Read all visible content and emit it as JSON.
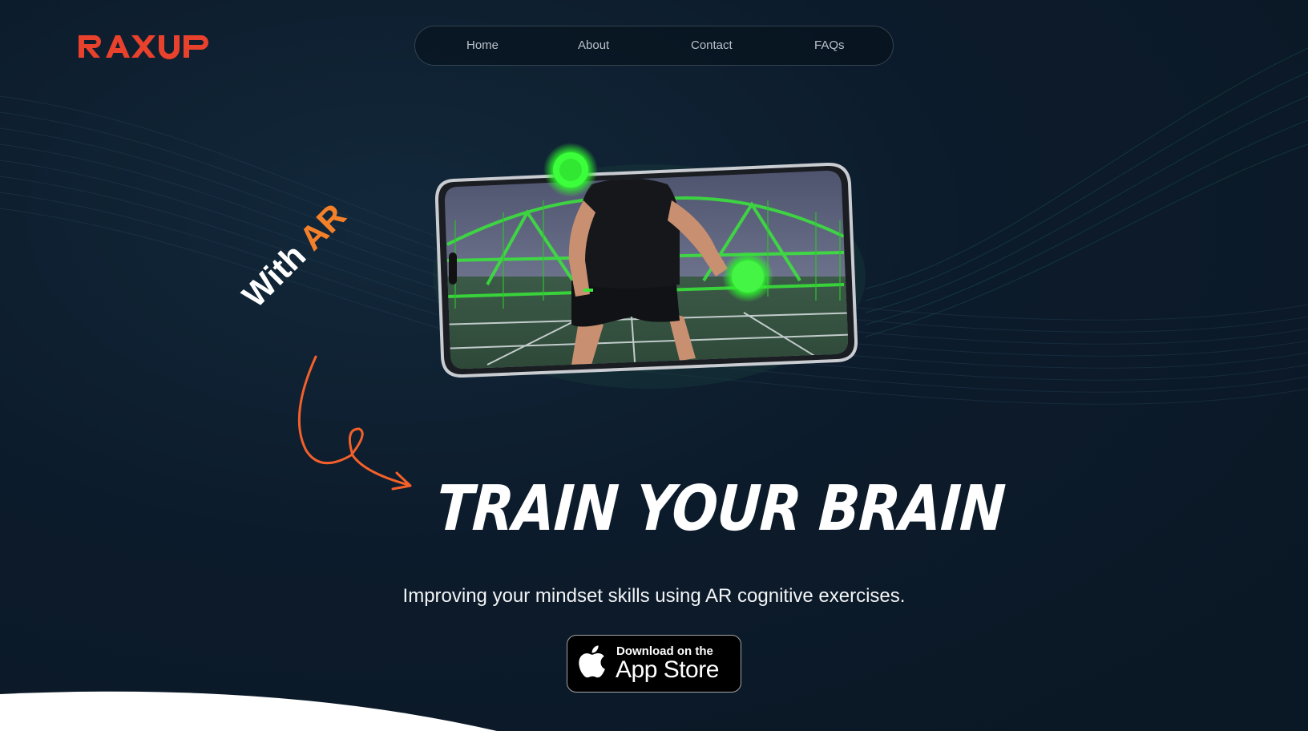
{
  "brand": {
    "logo_text": "RAXUP",
    "logo_color": "#e8412c"
  },
  "nav": {
    "items": [
      {
        "label": "Home"
      },
      {
        "label": "About"
      },
      {
        "label": "Contact"
      },
      {
        "label": "FAQs"
      }
    ]
  },
  "hero": {
    "tag_with": "With",
    "tag_ar": "AR",
    "headline": "TRAIN YOUR BRAIN",
    "subtitle": "Improving your mindset skills using AR cognitive exercises.",
    "image_icon": "phone-ar-preview-image",
    "accent_orange": "#f4802a",
    "ar_ball_color": "#3cff3c"
  },
  "cta": {
    "small_label": "Download on the",
    "big_label": "App Store",
    "icon": "apple-icon"
  }
}
